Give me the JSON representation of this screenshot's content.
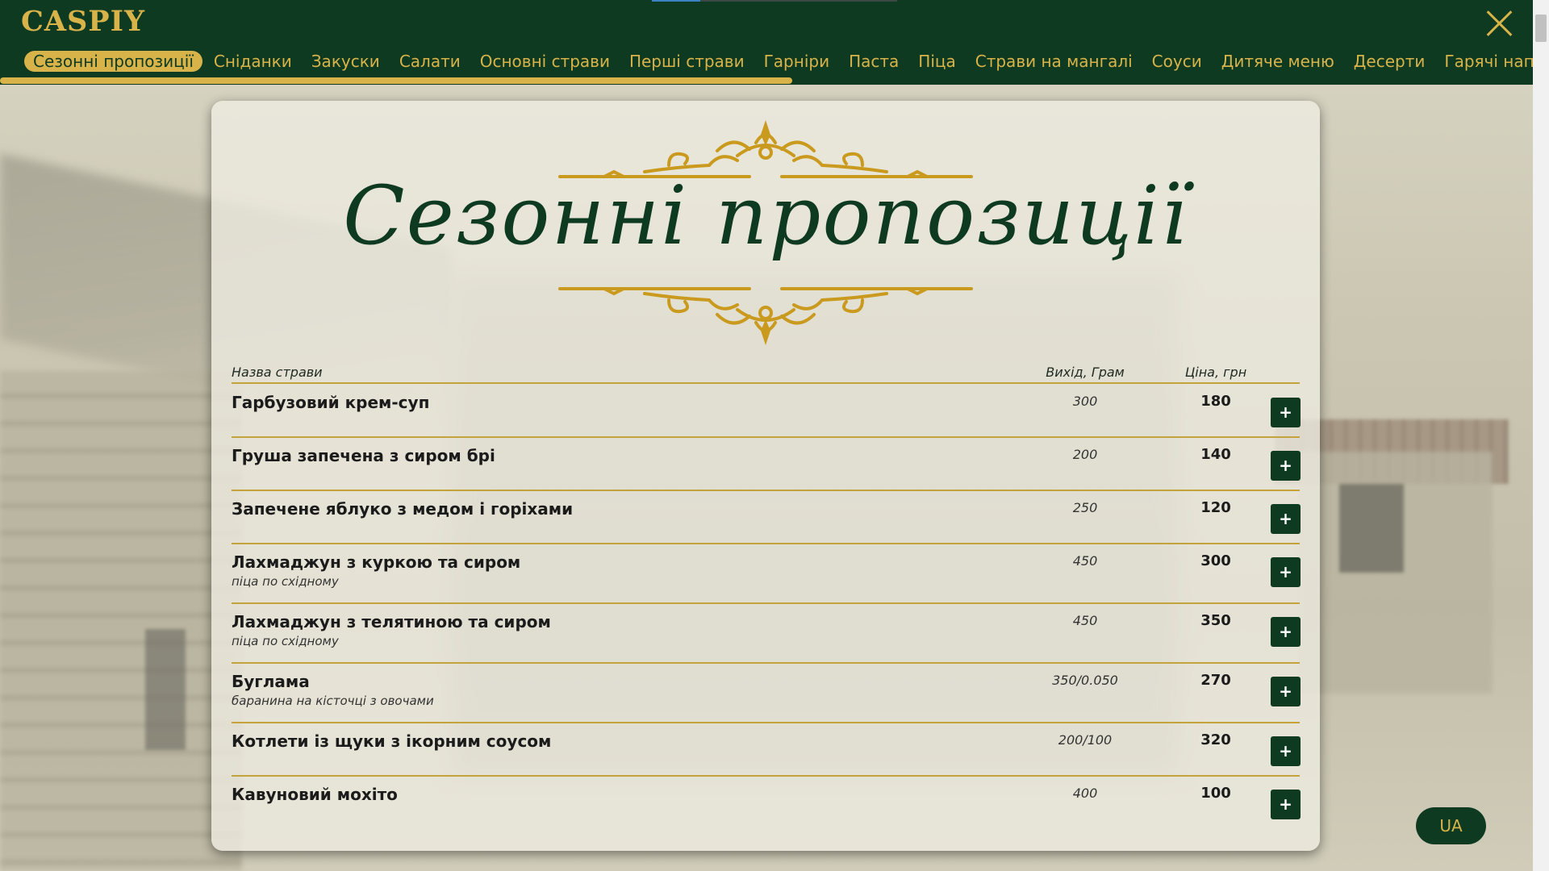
{
  "brand": {
    "logo": "CASPIY",
    "accent": "#d7b34a",
    "primary": "#0f3a22"
  },
  "nav": {
    "items": [
      {
        "label": "Сезонні пропозиції",
        "active": true
      },
      {
        "label": "Сніданки"
      },
      {
        "label": "Закуски"
      },
      {
        "label": "Салати"
      },
      {
        "label": "Основні страви"
      },
      {
        "label": "Перші страви"
      },
      {
        "label": "Гарніри"
      },
      {
        "label": "Паста"
      },
      {
        "label": "Піца"
      },
      {
        "label": "Страви на мангалі"
      },
      {
        "label": "Соуси"
      },
      {
        "label": "Дитяче меню"
      },
      {
        "label": "Десерти"
      },
      {
        "label": "Гарячі напої"
      }
    ]
  },
  "section": {
    "title": "Сезонні пропозиції"
  },
  "table": {
    "headers": {
      "name": "Назва страви",
      "weight": "Вихід, Грам",
      "price": "Ціна, грн"
    },
    "rows": [
      {
        "name": "Гарбузовий крем-суп",
        "desc": "",
        "weight": "300",
        "price": "180"
      },
      {
        "name": "Груша запечена з сиром брі",
        "desc": "",
        "weight": "200",
        "price": "140"
      },
      {
        "name": "Запечене яблуко з медом і горіхами",
        "desc": "",
        "weight": "250",
        "price": "120"
      },
      {
        "name": "Лахмаджун з куркою та сиром",
        "desc": "піца по східному",
        "weight": "450",
        "price": "300"
      },
      {
        "name": "Лахмаджун з телятиною та сиром",
        "desc": "піца по східному",
        "weight": "450",
        "price": "350"
      },
      {
        "name": "Буглама",
        "desc": "баранина на кісточці з овочами",
        "weight": "350/0.050",
        "price": "270"
      },
      {
        "name": "Котлети із щуки з ікорним соусом",
        "desc": "",
        "weight": "200/100",
        "price": "320"
      },
      {
        "name": "Кавуновий мохіто",
        "desc": "",
        "weight": "400",
        "price": "100"
      }
    ],
    "add_label": "+"
  },
  "lang": {
    "label": "UA"
  }
}
